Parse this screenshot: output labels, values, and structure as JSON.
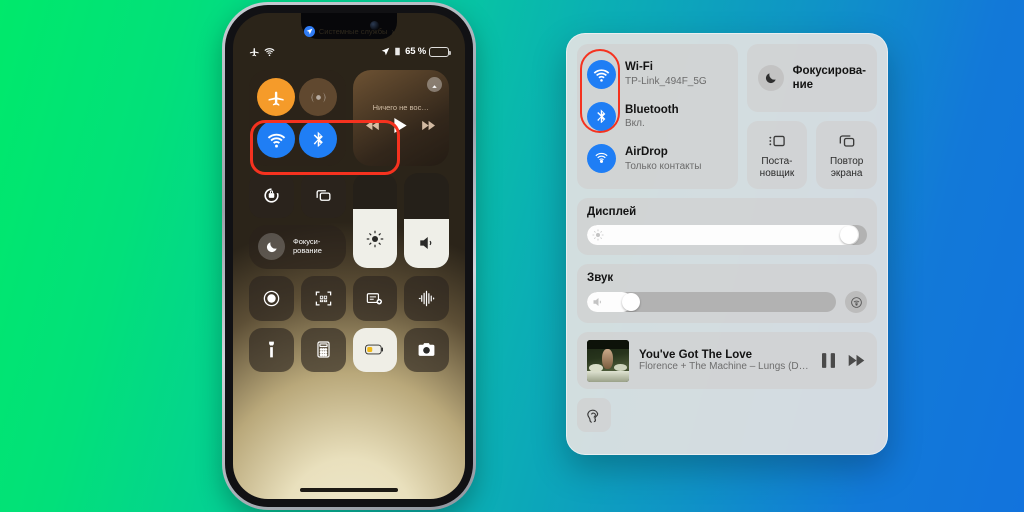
{
  "background": {
    "from": "#00e96b",
    "mid": "#0bafb4",
    "to": "#1273dd"
  },
  "highlight_color": "#f5321f",
  "phone": {
    "system_services": {
      "label": "Системные службы",
      "chevron": "›",
      "icon": "location-icon"
    },
    "status_bar": {
      "airplane_icon": "airplane-icon",
      "wifi_icon": "wifi-icon",
      "location_icon": "location-arrow-icon",
      "lock_icon": "orientation-lock-icon",
      "battery_percent": "65 %",
      "battery_level": 66
    },
    "connectivity": {
      "airplane": {
        "name": "airplane-mode-toggle",
        "state": "on"
      },
      "cellular": {
        "name": "cellular-data-toggle",
        "state": "off"
      },
      "wifi": {
        "name": "wifi-toggle",
        "state": "on"
      },
      "bluetooth": {
        "name": "bluetooth-toggle",
        "state": "on"
      }
    },
    "media": {
      "title": "Ничего не вос…",
      "airplay_icon": "airplay-icon",
      "prev_icon": "rewind-icon",
      "play_icon": "play-icon",
      "next_icon": "forward-icon"
    },
    "focus": {
      "label_line1": "Фокуси-",
      "label_line2": "рование",
      "icon": "moon-icon"
    },
    "tiles": {
      "rotation_lock": "rotation-lock-icon",
      "screen_mirroring": "screen-mirroring-icon",
      "brightness_value": 62,
      "volume_value": 52,
      "screen_record": "screen-record-icon",
      "qr_scanner": "qr-scanner-icon",
      "quick_note": "quick-note-icon",
      "sound_recognition": "sound-recognition-icon",
      "flashlight": "flashlight-icon",
      "calculator": "calculator-icon",
      "low_power": "low-power-mode-icon",
      "camera": "camera-icon"
    }
  },
  "mac": {
    "connectivity": [
      {
        "name": "wifi",
        "icon": "wifi-icon",
        "title": "Wi-Fi",
        "subtitle": "TP-Link_494F_5G",
        "highlighted": true
      },
      {
        "name": "bluetooth",
        "icon": "bluetooth-icon",
        "title": "Bluetooth",
        "subtitle": "Вкл.",
        "highlighted": true
      },
      {
        "name": "airdrop",
        "icon": "airdrop-icon",
        "title": "AirDrop",
        "subtitle": "Только контакты",
        "highlighted": false
      }
    ],
    "focus": {
      "label_line1": "Фокусирова-",
      "label_line2": "ние",
      "icon": "moon-icon"
    },
    "stage_manager": {
      "line1": "Поста-",
      "line2": "новщик",
      "icon": "stage-manager-icon"
    },
    "screen_mirroring": {
      "line1": "Повтор",
      "line2": "экрана",
      "icon": "screen-mirroring-icon"
    },
    "display": {
      "label": "Дисплей",
      "value": 97,
      "icon": "brightness-icon"
    },
    "sound": {
      "label": "Звук",
      "value": 18,
      "icon": "speaker-icon",
      "output_icon": "airplay-audio-icon"
    },
    "now_playing": {
      "title": "You've Got The Love",
      "subtitle": "Florence + The Machine – Lungs (D…",
      "artwork": "album-artwork",
      "pause_icon": "pause-icon",
      "next_icon": "forward-icon"
    },
    "accessibility": {
      "icon": "hearing-icon"
    }
  }
}
